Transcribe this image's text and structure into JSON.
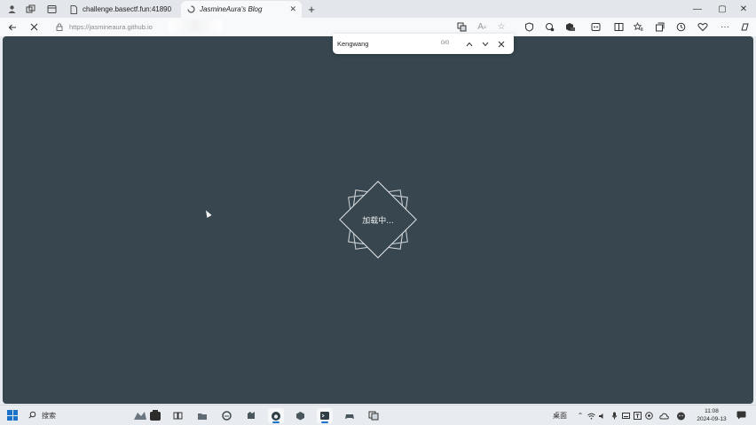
{
  "browser": {
    "tabs": [
      {
        "title": "challenge.basectf.fun:41890",
        "favicon": "page-icon",
        "active": false
      },
      {
        "title": "JasmineAura's Blog",
        "favicon": "loading-spinner-icon",
        "active": true
      }
    ],
    "new_tab_label": "+",
    "window_controls": {
      "minimize": "—",
      "maximize": "▢",
      "close": "✕"
    },
    "address": "https://jasmineaura.github.io"
  },
  "find_bar": {
    "query": "Kengwang",
    "count": "0/0"
  },
  "page": {
    "background": "#37464f",
    "loading_text": "加载中..."
  },
  "taskbar": {
    "search_placeholder": "搜索",
    "tray_label": "桌面",
    "time": "11:08",
    "date": "2024-09-13"
  }
}
